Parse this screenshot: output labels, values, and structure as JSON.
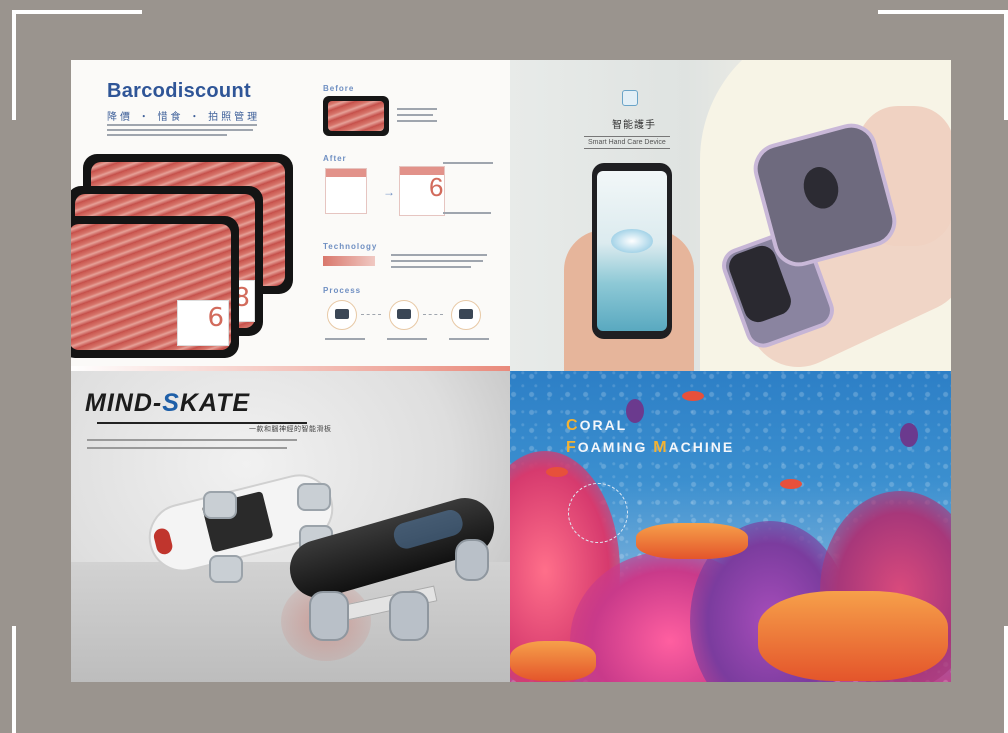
{
  "panels": {
    "barcodiscount": {
      "title": "Barcodiscount",
      "subtitle": "降價 ・ 惜食 ・ 拍照管理",
      "sections": {
        "before": "Before",
        "after": "After",
        "technology": "Technology",
        "process": "Process"
      },
      "label_numbers": [
        "8",
        "6"
      ],
      "after_number": "6"
    },
    "hand_care": {
      "title_cn": "智能護手",
      "title_en": "Smart Hand Care Device"
    },
    "mind_skate": {
      "title_part1": "MIND-",
      "title_s": "S",
      "title_part2": "KATE",
      "subtitle": "一款和腦神經的智能滑板"
    },
    "coral": {
      "line1_cap": "C",
      "line1_rest": "ORAL",
      "line2_cap1": "F",
      "line2_mid": "OAMING ",
      "line2_cap2": "M",
      "line2_rest": "ACHINE"
    }
  },
  "colors": {
    "frame_background": "#9a948e",
    "corner_marks": "#ffffff",
    "barcodiscount_blue": "#2f5597",
    "skate_accent": "#1e5fa8",
    "coral_accent": "#f2b233"
  }
}
